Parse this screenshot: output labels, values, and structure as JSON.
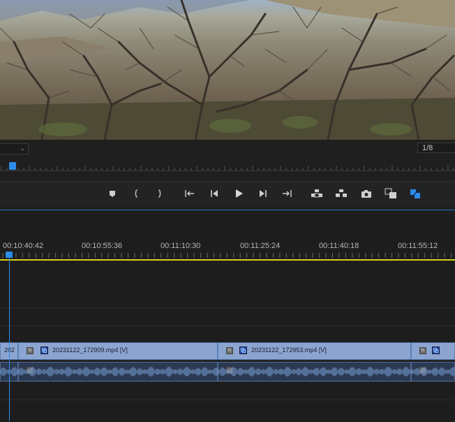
{
  "monitor": {
    "resolution_value": "1/8",
    "zoom_value": ""
  },
  "transport_buttons": [
    {
      "name": "add-marker-button",
      "icon": "marker-icon"
    },
    {
      "name": "mark-in-button",
      "icon": "mark-in-icon"
    },
    {
      "name": "mark-out-button",
      "icon": "mark-out-icon"
    },
    {
      "name": "go-to-in-button",
      "icon": "go-to-in-icon"
    },
    {
      "name": "step-back-button",
      "icon": "step-back-icon"
    },
    {
      "name": "play-button",
      "icon": "play-icon"
    },
    {
      "name": "step-forward-button",
      "icon": "step-forward-icon"
    },
    {
      "name": "go-to-out-button",
      "icon": "go-to-out-icon"
    },
    {
      "name": "lift-button",
      "icon": "lift-icon"
    },
    {
      "name": "extract-button",
      "icon": "extract-icon"
    },
    {
      "name": "export-frame-button",
      "icon": "camera-icon"
    },
    {
      "name": "comparison-view-button",
      "icon": "comparison-icon"
    },
    {
      "name": "proxy-toggle-button",
      "icon": "proxy-icon"
    }
  ],
  "timeline": {
    "timecodes": [
      "00:10:40:42",
      "00:10:55:36",
      "00:11:10:30",
      "00:11:25:24",
      "00:11:40:18",
      "00:11:55:12"
    ],
    "clips": [
      {
        "label": "202"
      },
      {
        "label": "20231122_172909.mp4 [V]"
      },
      {
        "label": "20231122_172953.mp4 [V]"
      },
      {
        "label": ""
      }
    ]
  },
  "colors": {
    "accent": "#2d8ceb",
    "work_area": "#d9d019",
    "video_clip": "#8ba5d0",
    "audio_clip": "#2b3a52"
  }
}
